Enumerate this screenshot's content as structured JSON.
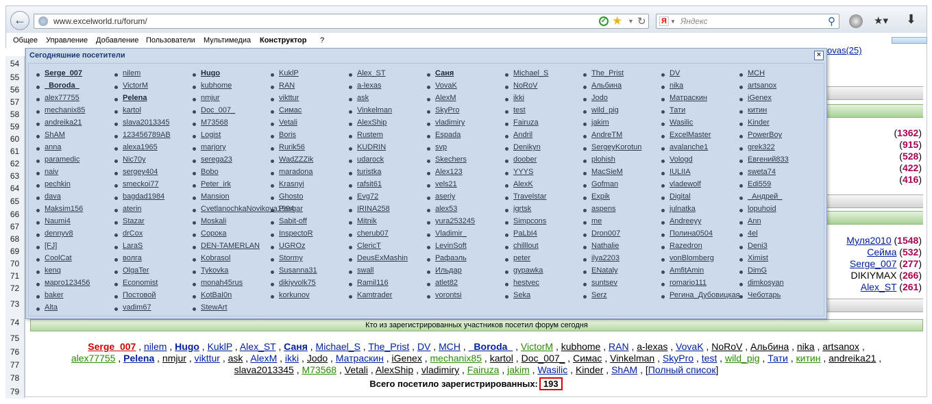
{
  "browser": {
    "url": "www.excelworld.ru/forum/",
    "search_placeholder": "Яндекс"
  },
  "menu": [
    "Общее",
    "Управление",
    "Добавление",
    "Пользователи",
    "Мультимедиа",
    "Конструктор",
    "?"
  ],
  "row_numbers": [
    "54",
    "55",
    "56",
    "57",
    "58",
    "59",
    "60",
    "61",
    "62",
    "63",
    "64",
    "65",
    "66",
    "67",
    "68",
    "69",
    "70",
    "71",
    "72",
    "73",
    "74",
    "75",
    "76",
    "77",
    "78",
    "79"
  ],
  "partial_top_text": "ovas(25)",
  "right_list_top": [
    {
      "count": "1362"
    },
    {
      "count": "915"
    },
    {
      "count": "528"
    },
    {
      "count": "422"
    },
    {
      "count": "416"
    }
  ],
  "right_list_bottom": [
    {
      "user": "Муля2010",
      "count": "1548"
    },
    {
      "user": "Сейма",
      "count": "532"
    },
    {
      "user": "Serge_007",
      "count": "277"
    },
    {
      "user": "DIKIYMAX",
      "count": "266"
    },
    {
      "user": "Alex_ST",
      "count": "261"
    }
  ],
  "popup": {
    "title": "Сегодняшние посетители",
    "close_label": "×",
    "columns": [
      [
        "Serge_007",
        "_Boroda_",
        "alex77755",
        "mechanix85",
        "andreika21",
        "ShAM",
        "anna",
        "paramedic",
        "naiv",
        "pechkin",
        "dava",
        "Maksim156",
        "Naumi4",
        "dennyv8",
        "[FJ]",
        "CoolCat",
        "kenq",
        "марго123456",
        "baker",
        "Alta"
      ],
      [
        "nilem",
        "VictorM",
        "Pelena",
        "kartol",
        "slava2013345",
        "123456789AB",
        "alexa1965",
        "Nic70y",
        "sergey404",
        "smeckoi77",
        "bagdad1984",
        "aterin",
        "Stazar",
        "drCox",
        "LaraS",
        "волга",
        "OlgaTer",
        "Economist",
        "Постовой",
        "vadim67"
      ],
      [
        "Hugo",
        "kubhome",
        "nmjur",
        "Doc_007_",
        "M73568",
        "Logist",
        "marjory",
        "serega23",
        "Bobo",
        "Peter_irk",
        "Mansion",
        "CvetlanochkaNovikova1994",
        "Moskali",
        "Сорока",
        "DEN-TAMERLAN",
        "Kobrasol",
        "Tykovka",
        "monah45rus",
        "KotBaI0n",
        "StewArt"
      ],
      [
        "KuklP",
        "RAN",
        "vikttur",
        "Симас",
        "Vetali",
        "Boris",
        "Rurik56",
        "WadZZZik",
        "maradona",
        "Krasnyi",
        "Ghosto",
        "Pasgar",
        "Sabit-off",
        "InspectoR",
        "UGROz",
        "Stormy",
        "Susanna31",
        "dikiyvolk75",
        "korkunov"
      ],
      [
        "Alex_ST",
        "a-lexas",
        "ask",
        "Vinkelman",
        "AlexShip",
        "Rustem",
        "KUDRIN",
        "udarock",
        "turistka",
        "rafsit61",
        "Evg72",
        "IRINA258",
        "Mitnik",
        "cherub07",
        "ClericT",
        "DeusExMashin",
        "swall",
        "Ramil116",
        "Kamtrader"
      ],
      [
        "Саня",
        "VovaK",
        "AlexM",
        "SkyPro",
        "vladimiry",
        "Espada",
        "svp",
        "Skechers",
        "Alex123",
        "vels21",
        "aseriy",
        "alex53",
        "yura253245",
        "Vladimir_",
        "LevinSoft",
        "Рафаэль",
        "Ильдар",
        "atlet82",
        "vorontsi"
      ],
      [
        "Michael_S",
        "NoRoV",
        "ikki",
        "test",
        "Fairuza",
        "Andril",
        "Denikyn",
        "doober",
        "YYYS",
        "AlexK",
        "Travelstar",
        "igrtsk",
        "Simpcons",
        "PaLbI4",
        "chilllout",
        "peter",
        "gypawka",
        "hestvec",
        "Seka"
      ],
      [
        "The_Prist",
        "Альбина",
        "Jodo",
        "wild_pig",
        "jakim",
        "AndreTM",
        "SergeyKorotun",
        "plohish",
        "MacSieM",
        "Gofman",
        "Expik",
        "aspens",
        "me",
        "Dron007",
        "Nathalie",
        "ilya2203",
        "ENataly",
        "suntsev",
        "Serz"
      ],
      [
        "DV",
        "nika",
        "Матраскин",
        "Тати",
        "Wasilic",
        "ExcelMaster",
        "avalanche1",
        "Vologd",
        "IULIIA",
        "vladewolf",
        "Digital",
        "julnatka",
        "Andreeyy",
        "Полина0504",
        "Razedron",
        "vonBlomberg",
        "AmfitAmin",
        "romario111",
        "Регина_Дубовицкая"
      ],
      [
        "MCH",
        "artsanox",
        "iGenex",
        "китин",
        "Kinder",
        "PowerBoy",
        "grek322",
        "Евгений833",
        "sweta74",
        "Edi559",
        "_Андрей_",
        "lopuhoid",
        "Ann",
        "4el",
        "Deni3",
        "Ximist",
        "DimG",
        "dimkosyan",
        "Чеботарь"
      ]
    ]
  },
  "footer": {
    "header": "Кто из зарегистрированных участников посетил форум сегодня",
    "list_line1": [
      {
        "name": "Serge_007",
        "cls": "c-red"
      },
      {
        "name": "nilem",
        "cls": "c-blue"
      },
      {
        "name": "Hugo",
        "cls": "c-blueb"
      },
      {
        "name": "KuklP",
        "cls": "c-blue"
      },
      {
        "name": "Alex_ST",
        "cls": "c-blue"
      },
      {
        "name": "Саня",
        "cls": "c-blueb"
      },
      {
        "name": "Michael_S",
        "cls": "c-blue"
      },
      {
        "name": "The_Prist",
        "cls": "c-blue"
      },
      {
        "name": "DV",
        "cls": "c-blue"
      },
      {
        "name": "MCH",
        "cls": "c-blue"
      },
      {
        "name": "_Boroda_",
        "cls": "c-blueb"
      },
      {
        "name": "VictorM",
        "cls": "c-green"
      },
      {
        "name": "kubhome",
        "cls": "c-black"
      },
      {
        "name": "RAN",
        "cls": "c-blue"
      },
      {
        "name": "a-lexas",
        "cls": "c-black"
      },
      {
        "name": "VovaK",
        "cls": "c-blue"
      },
      {
        "name": "NoRoV",
        "cls": "c-black"
      },
      {
        "name": "Альбина",
        "cls": "c-black"
      },
      {
        "name": "nika",
        "cls": "c-black"
      },
      {
        "name": "artsanox",
        "cls": "c-black"
      }
    ],
    "list_line2": [
      {
        "name": "alex77755",
        "cls": "c-green"
      },
      {
        "name": "Pelena",
        "cls": "c-blueb"
      },
      {
        "name": "nmjur",
        "cls": "c-black"
      },
      {
        "name": "vikttur",
        "cls": "c-blue"
      },
      {
        "name": "ask",
        "cls": "c-black"
      },
      {
        "name": "AlexM",
        "cls": "c-blue"
      },
      {
        "name": "ikki",
        "cls": "c-blue"
      },
      {
        "name": "Jodo",
        "cls": "c-black"
      },
      {
        "name": "Матраскин",
        "cls": "c-blue"
      },
      {
        "name": "iGenex",
        "cls": "c-black"
      },
      {
        "name": "mechanix85",
        "cls": "c-green"
      },
      {
        "name": "kartol",
        "cls": "c-black"
      },
      {
        "name": "Doc_007_",
        "cls": "c-black"
      },
      {
        "name": "Симас",
        "cls": "c-black"
      },
      {
        "name": "Vinkelman",
        "cls": "c-black"
      },
      {
        "name": "SkyPro",
        "cls": "c-blue"
      },
      {
        "name": "test",
        "cls": "c-blue"
      },
      {
        "name": "wild_pig",
        "cls": "c-green"
      },
      {
        "name": "Тати",
        "cls": "c-blue"
      },
      {
        "name": "китин",
        "cls": "c-green"
      },
      {
        "name": "andreika21",
        "cls": "c-black"
      }
    ],
    "list_line3": [
      {
        "name": "slava2013345",
        "cls": "c-black"
      },
      {
        "name": "M73568",
        "cls": "c-green"
      },
      {
        "name": "Vetali",
        "cls": "c-black"
      },
      {
        "name": "AlexShip",
        "cls": "c-black"
      },
      {
        "name": "vladimiry",
        "cls": "c-black"
      },
      {
        "name": "Fairuza",
        "cls": "c-green"
      },
      {
        "name": "jakim",
        "cls": "c-green"
      },
      {
        "name": "Wasilic",
        "cls": "c-blue"
      },
      {
        "name": "Kinder",
        "cls": "c-black"
      },
      {
        "name": "ShAM",
        "cls": "c-blue"
      }
    ],
    "full_list_label": "Полный список",
    "total_label": "Всего посетило зарегистрированных:",
    "total_value": "193"
  }
}
